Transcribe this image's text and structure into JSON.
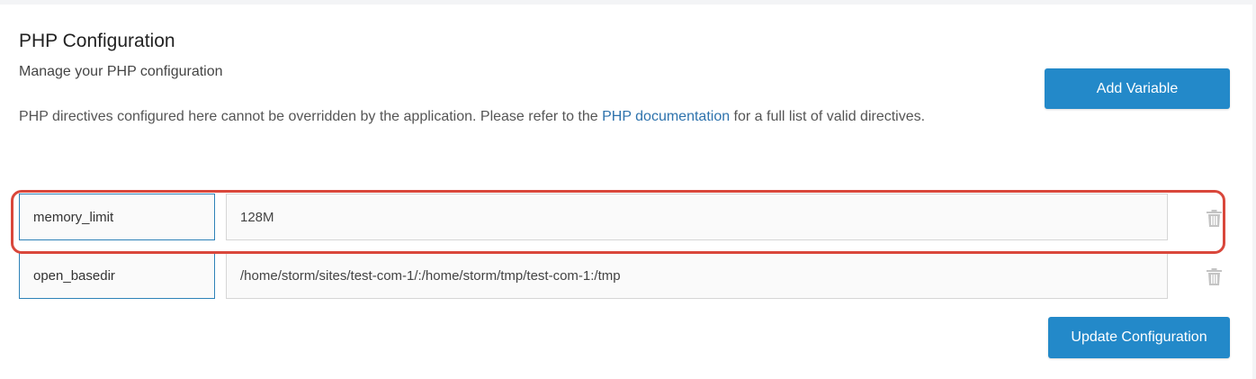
{
  "section": {
    "title": "PHP Configuration",
    "subtitle": "Manage your PHP configuration",
    "description_before": "PHP directives configured here cannot be overridden by the application. Please refer to the ",
    "description_link": "PHP documentation",
    "description_after": " for a full list of valid directives."
  },
  "buttons": {
    "add_variable": "Add Variable",
    "update_configuration": "Update Configuration"
  },
  "variables": [
    {
      "key": "memory_limit",
      "value": "128M",
      "highlighted": true
    },
    {
      "key": "open_basedir",
      "value": "/home/storm/sites/test-com-1/:/home/storm/tmp/test-com-1:/tmp",
      "highlighted": false
    }
  ],
  "icons": {
    "delete": "trash-icon"
  },
  "colors": {
    "primary_button": "#2389c9",
    "link": "#2e73ad",
    "key_border": "#2e82b8",
    "highlight": "#d9473b",
    "trash": "#c4c4c4"
  }
}
